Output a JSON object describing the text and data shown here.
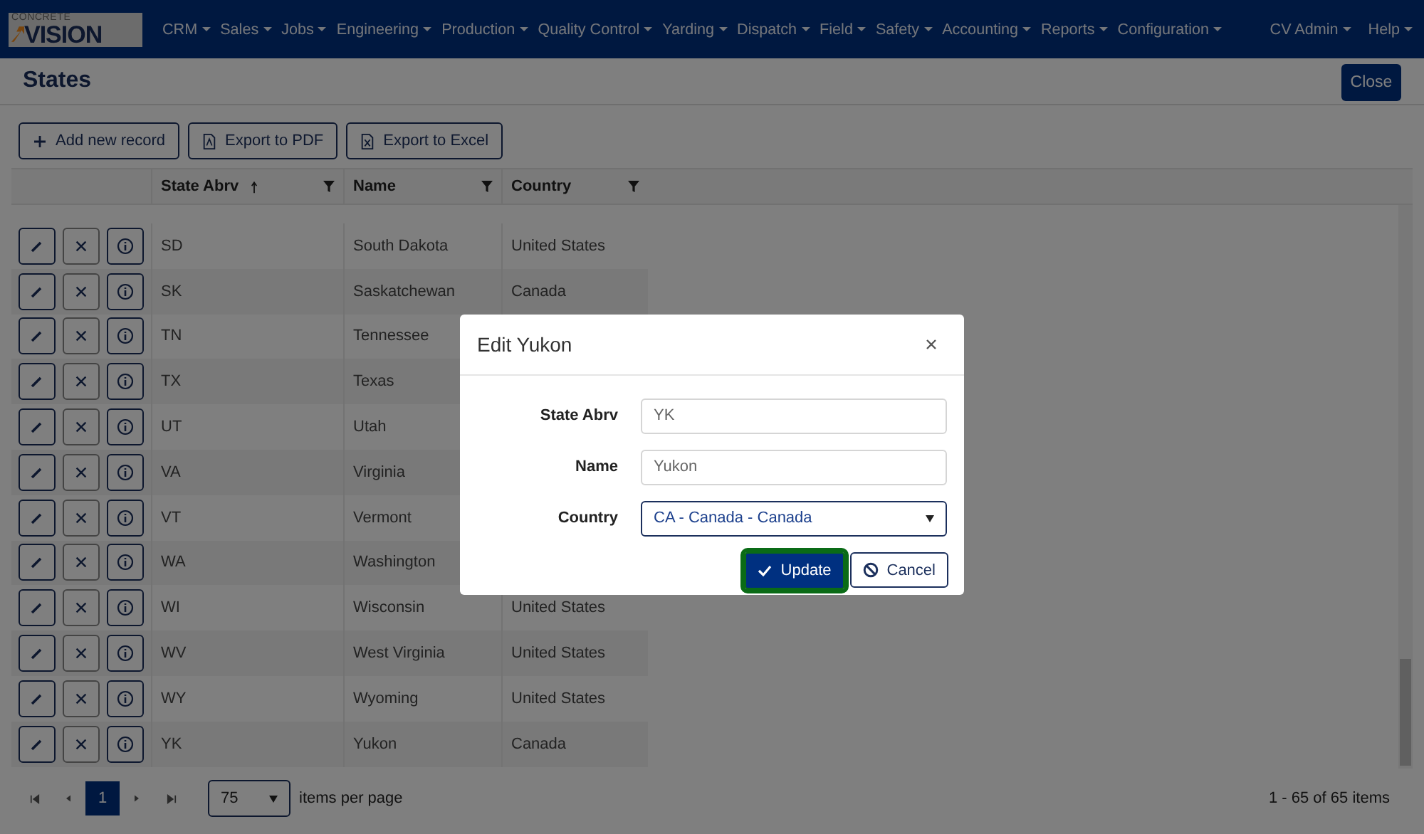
{
  "nav": {
    "logo_top": "CONCRETE",
    "logo_main": "VISION",
    "menus": [
      "CRM",
      "Sales",
      "Jobs",
      "Engineering",
      "Production",
      "Quality Control",
      "Yarding",
      "Dispatch",
      "Field",
      "Safety",
      "Accounting",
      "Reports",
      "Configuration"
    ],
    "user_menus": [
      "CV Admin",
      "Help"
    ]
  },
  "page": {
    "title": "States",
    "close_button": "Close"
  },
  "toolbar": [
    {
      "label": "Add new record",
      "kind": "add"
    },
    {
      "label": "Export to PDF",
      "kind": "pdf"
    },
    {
      "label": "Export to Excel",
      "kind": "excel"
    }
  ],
  "grid": {
    "columns": [
      {
        "label": "State Abrv",
        "sorted": true
      },
      {
        "label": "Name",
        "sorted": false
      },
      {
        "label": "Country",
        "sorted": false
      }
    ],
    "rows": [
      {
        "abrv": "SD",
        "name": "South Dakota",
        "country": "United States"
      },
      {
        "abrv": "SK",
        "name": "Saskatchewan",
        "country": "Canada"
      },
      {
        "abrv": "TN",
        "name": "Tennessee"
      },
      {
        "abrv": "TX",
        "name": "Texas"
      },
      {
        "abrv": "UT",
        "name": "Utah"
      },
      {
        "abrv": "VA",
        "name": "Virginia"
      },
      {
        "abrv": "VT",
        "name": "Vermont"
      },
      {
        "abrv": "WA",
        "name": "Washington"
      },
      {
        "abrv": "WI",
        "name": "Wisconsin",
        "country": "United States"
      },
      {
        "abrv": "WV",
        "name": "West Virginia",
        "country": "United States"
      },
      {
        "abrv": "WY",
        "name": "Wyoming",
        "country": "United States"
      },
      {
        "abrv": "YK",
        "name": "Yukon",
        "country": "Canada"
      }
    ]
  },
  "pager": {
    "current_page": "1",
    "page_size": "75",
    "page_size_label": "items per page",
    "summary": "1 - 65 of 65 items"
  },
  "modal": {
    "title": "Edit Yukon",
    "fields": [
      {
        "label": "State Abrv",
        "value": "YK",
        "kind": "text"
      },
      {
        "label": "Name",
        "value": "Yukon",
        "kind": "text"
      },
      {
        "label": "Country",
        "value": "CA - Canada - Canada",
        "kind": "select"
      }
    ],
    "update_button": {
      "label": "Update",
      "focused": true
    },
    "cancel_button": "Cancel"
  }
}
